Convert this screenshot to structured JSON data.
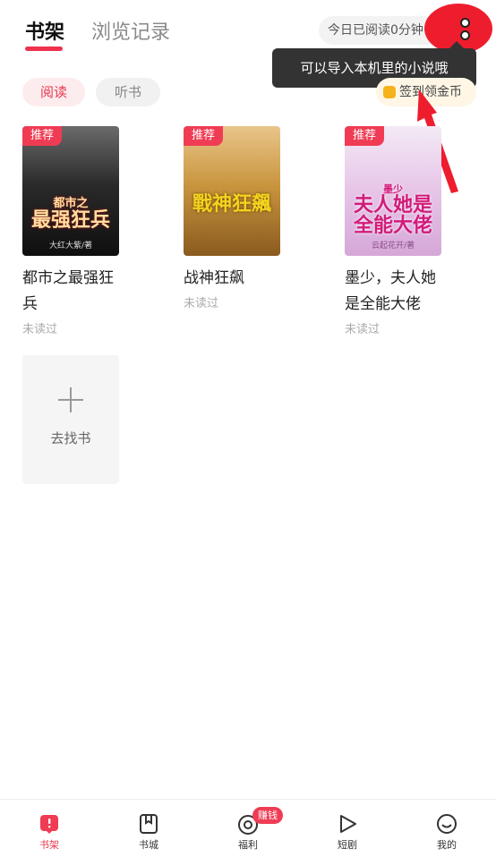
{
  "header": {
    "tab_bookshelf": "书架",
    "tab_history": "浏览记录",
    "read_time": "今日已阅读0分钟"
  },
  "tooltip": "可以导入本机里的小说哦",
  "filters": {
    "read": "阅读",
    "listen": "听书"
  },
  "signin": "签到领金币",
  "books": [
    {
      "badge": "推荐",
      "cover_top": "都市之",
      "cover_title": "最强狂兵",
      "cover_author": "大红大紫/著",
      "title": "都市之最强狂兵",
      "status": "未读过"
    },
    {
      "badge": "推荐",
      "cover_top": "",
      "cover_title": "戰神狂飆",
      "cover_author": "",
      "title": "战神狂飙",
      "status": "未读过"
    },
    {
      "badge": "推荐",
      "cover_top": "墨少",
      "cover_title": "夫人她是全能大佬",
      "cover_author": "云起花开/著",
      "title": "墨少，夫人她是全能大佬",
      "status": "未读过"
    }
  ],
  "add_book_label": "去找书",
  "nav": {
    "items": [
      {
        "label": "书架",
        "icon": "bookshelf-icon"
      },
      {
        "label": "书城",
        "icon": "bookstore-icon"
      },
      {
        "label": "福利",
        "icon": "welfare-icon"
      },
      {
        "label": "短剧",
        "icon": "play-icon"
      },
      {
        "label": "我的",
        "icon": "profile-icon"
      }
    ],
    "earn_badge": "赚钱"
  },
  "colors": {
    "accent": "#ef3c54",
    "annotation": "#ee1d2e"
  }
}
